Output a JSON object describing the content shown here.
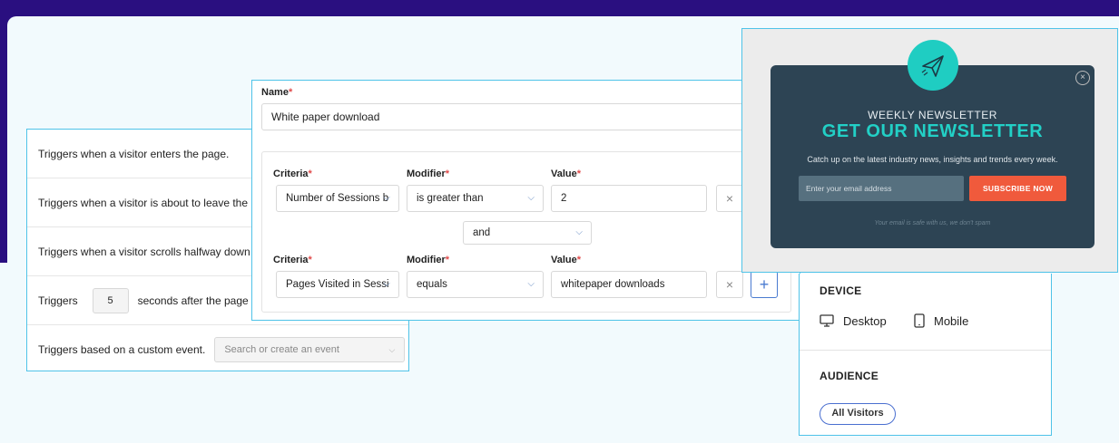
{
  "triggers": {
    "rows": [
      "Triggers when a visitor enters the page.",
      "Triggers when a visitor is about to leave the page.",
      "Triggers when a visitor scrolls halfway down the p"
    ],
    "time_prefix": "Triggers",
    "time_value": "5",
    "time_suffix": "seconds after the page loads.",
    "custom_label": "Triggers based on a custom event.",
    "custom_placeholder": "Search or create an event"
  },
  "segment": {
    "name_label": "Name",
    "name_value": "White paper download",
    "criteria_label": "Criteria",
    "modifier_label": "Modifier",
    "value_label": "Value",
    "rule1": {
      "criteria": "Number of Sessions b",
      "modifier": "is greater than",
      "value": "2"
    },
    "joiner": "and",
    "rule2": {
      "criteria": "Pages Visited in Sessi",
      "modifier": "equals",
      "value": "whitepaper downloads"
    },
    "remove_symbol": "×",
    "add_symbol": "+"
  },
  "newsletter": {
    "kicker": "WEEKLY NEWSLETTER",
    "title": "GET OUR NEWSLETTER",
    "subtitle": "Catch up on the latest industry news, insights and trends every week.",
    "email_placeholder": "Enter your email address",
    "button": "SUBSCRIBE NOW",
    "note": "Your email is safe with us, we don't spam",
    "close_symbol": "×"
  },
  "device": {
    "heading": "DEVICE",
    "desktop": "Desktop",
    "mobile": "Mobile"
  },
  "audience": {
    "heading": "AUDIENCE",
    "pill": "All Visitors"
  },
  "colors": {
    "accent_border": "#4fc3e8",
    "brand_purple": "#2a0f80",
    "newsletter_teal": "#22d0c6",
    "subscribe_orange": "#f05a3c"
  }
}
